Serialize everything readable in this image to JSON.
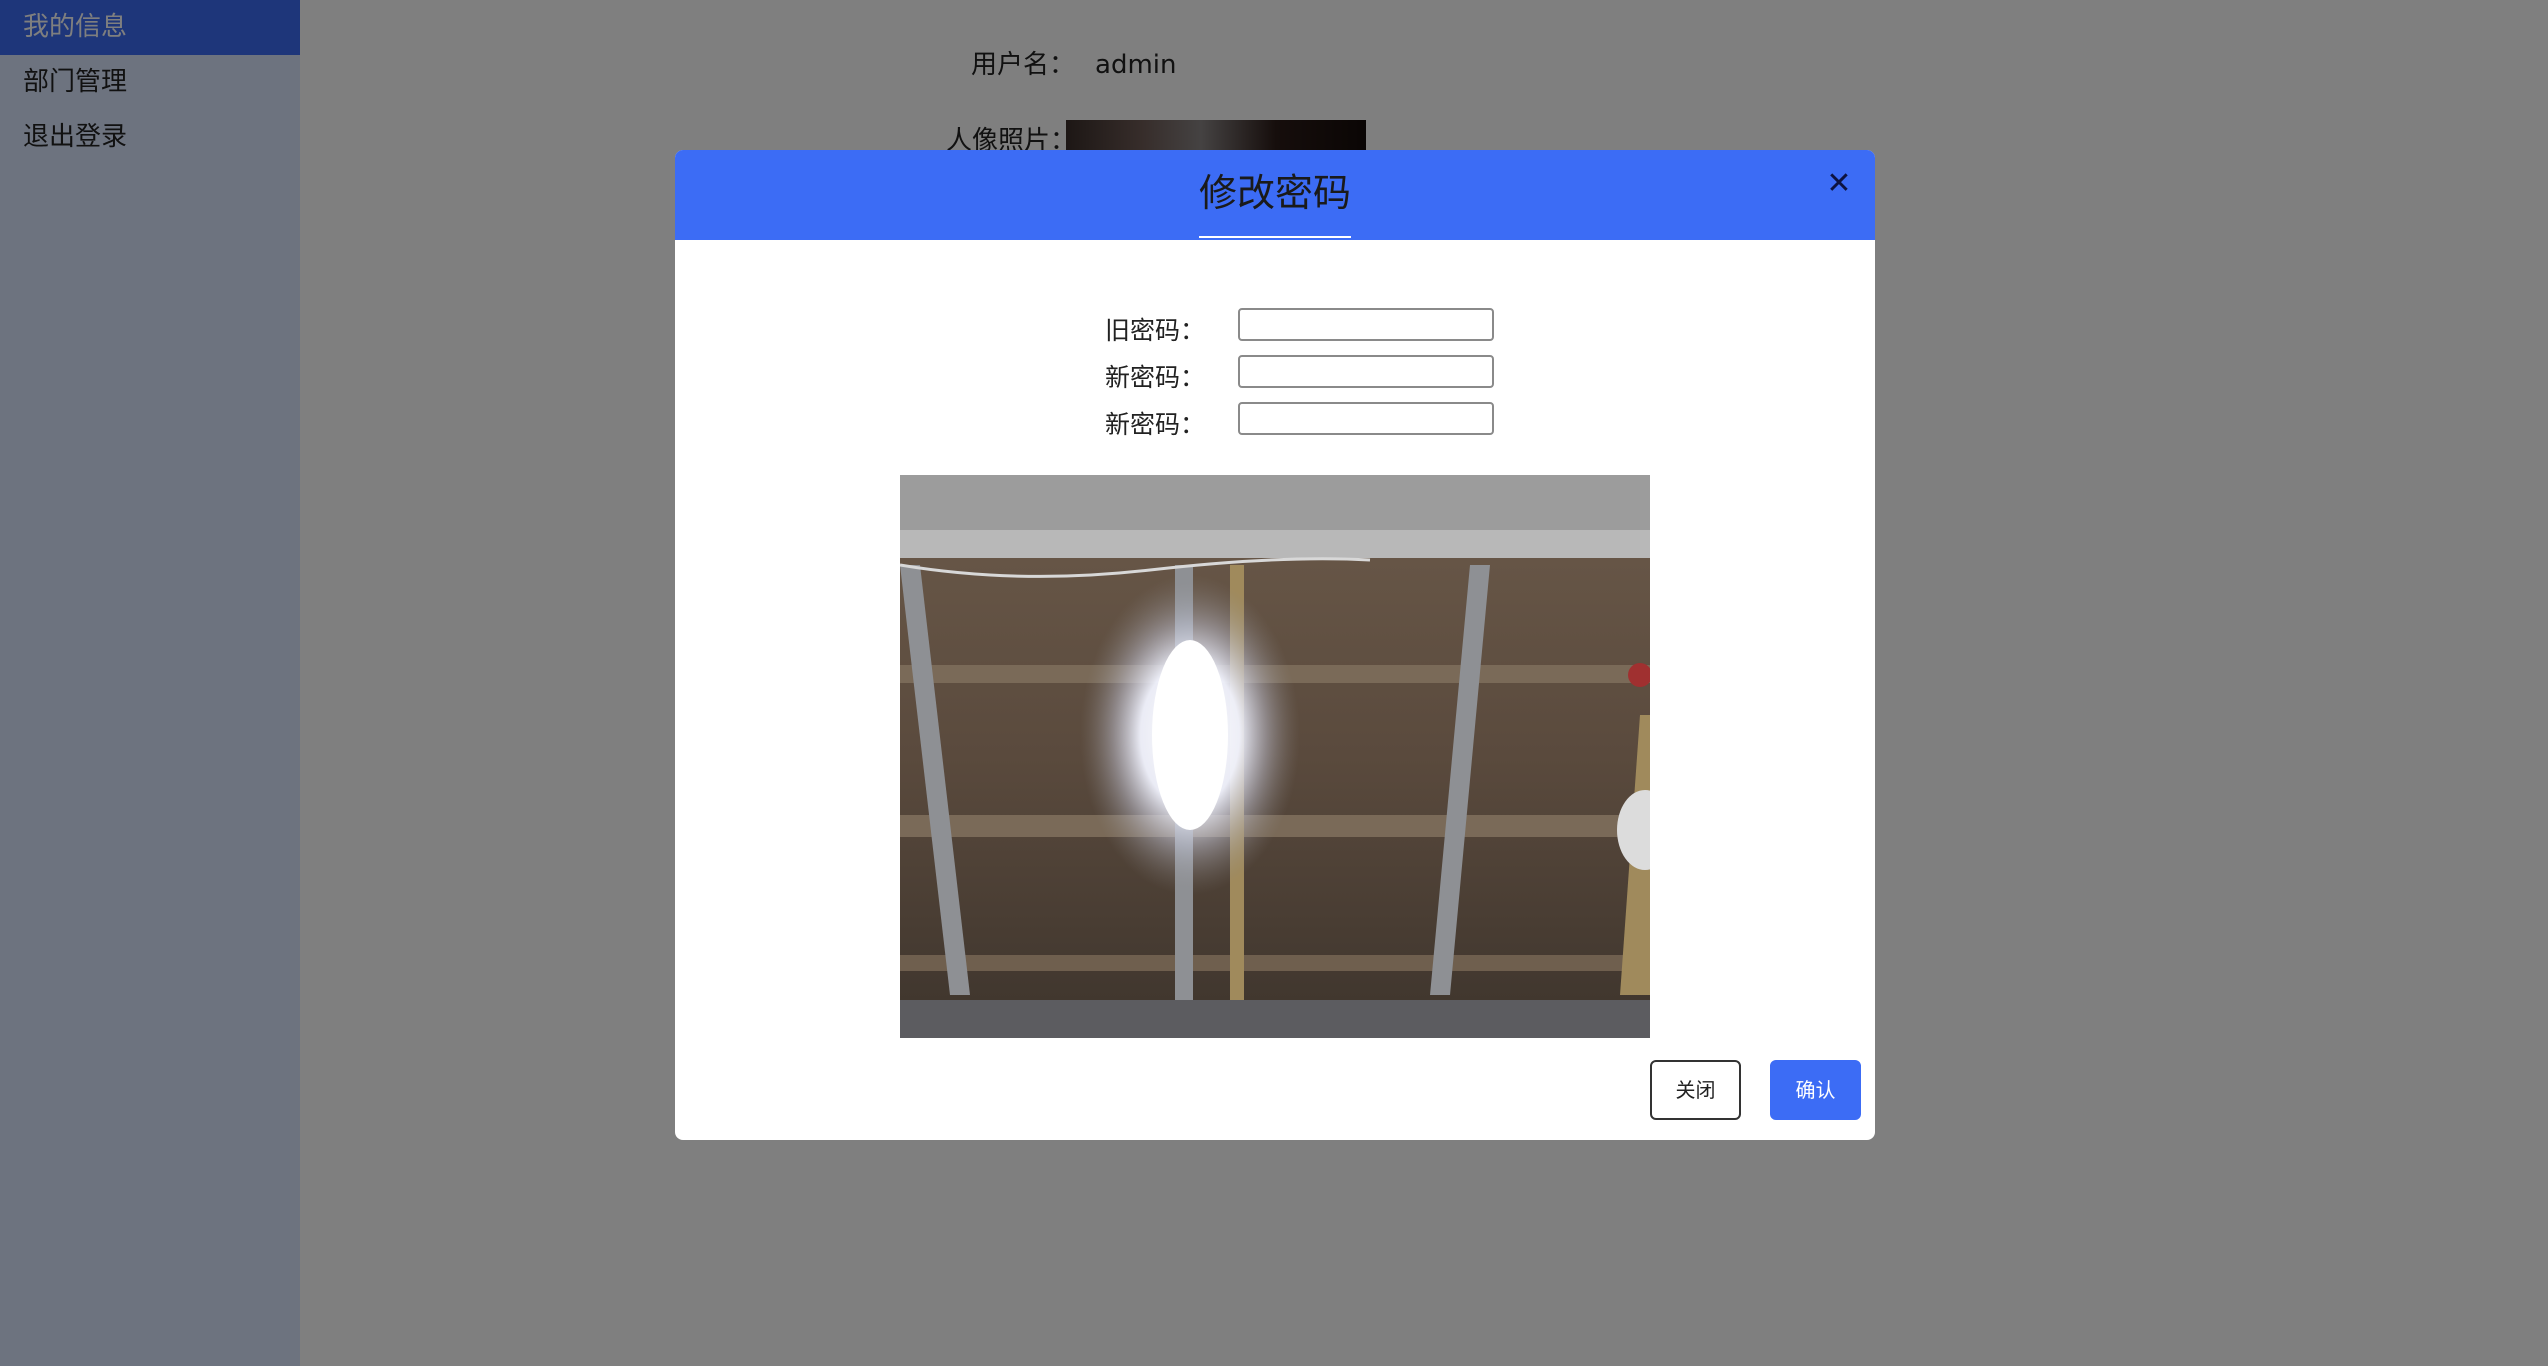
{
  "sidebar": {
    "items": [
      {
        "label": "我的信息",
        "active": true
      },
      {
        "label": "部门管理",
        "active": false
      },
      {
        "label": "退出登录",
        "active": false
      }
    ]
  },
  "profile": {
    "username_label": "用户名：",
    "username_value": "admin",
    "photo_label": "人像照片："
  },
  "modal": {
    "title": "修改密码",
    "close_icon": "close-icon",
    "fields": [
      {
        "label": "旧密码：",
        "value": ""
      },
      {
        "label": "新密码：",
        "value": ""
      },
      {
        "label": "新密码：",
        "value": ""
      }
    ],
    "buttons": {
      "close_label": "关闭",
      "confirm_label": "确认"
    }
  },
  "colors": {
    "accent": "#3c6cf5",
    "sidebar_bg": "#dbe6ff",
    "overlay": "rgba(0,0,0,0.5)"
  }
}
